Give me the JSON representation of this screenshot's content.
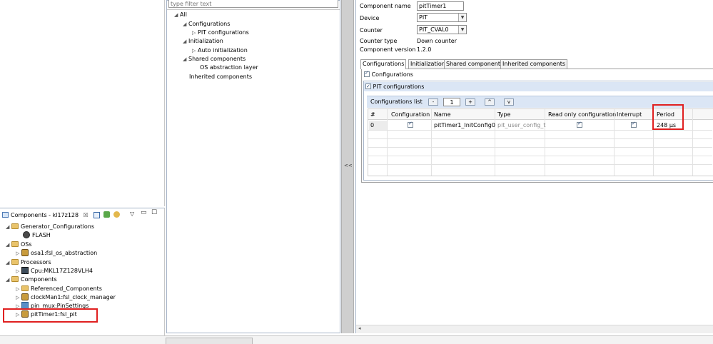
{
  "filter": {
    "placeholder": "type filter text"
  },
  "tree": {
    "all": "All",
    "configurations": "Configurations",
    "pit_configurations": "PIT configurations",
    "initialization": "Initialization",
    "auto_initialization": "Auto initialization",
    "shared_components": "Shared components",
    "os_abstraction_layer": "OS abstraction layer",
    "inherited_components": "Inherited components"
  },
  "collapse_label": "<<",
  "component": {
    "name_label": "Component name",
    "name_value": "pitTimer1",
    "device_label": "Device",
    "device_value": "PIT",
    "counter_label": "Counter",
    "counter_value": "PIT_CVAL0",
    "counter_type_label": "Counter type",
    "counter_type_value": "Down counter",
    "version_label": "Component version",
    "version_value": "1.2.0"
  },
  "tabs": [
    "Configurations",
    "Initialization",
    "Shared components",
    "Inherited components"
  ],
  "config_checkbox_label": "Configurations",
  "pit_section_label": "PIT configurations",
  "config_list": {
    "label": "Configurations list",
    "minus": "-",
    "count": "1",
    "plus": "+",
    "up": "^",
    "down": "v"
  },
  "table": {
    "headers": [
      "#",
      "Configuration",
      "Name",
      "Type",
      "Read only configuration",
      "Interrupt",
      "Period"
    ],
    "row": {
      "index": "0",
      "name": "pitTimer1_InitConfig0",
      "type": "pit_user_config_t",
      "period": "248 µs"
    }
  },
  "components_view": {
    "title": "Components - kl17z128",
    "items": {
      "generator": "Generator_Configurations",
      "flash": "FLASH",
      "oss": "OSs",
      "osa": "osa1:fsl_os_abstraction",
      "processors": "Processors",
      "cpu": "Cpu:MKL17Z128VLH4",
      "components": "Components",
      "referenced": "Referenced_Components",
      "clockman": "clockMan1:fsl_clock_manager",
      "pinmux": "pin_mux:PinSettings",
      "pittimer": "pitTimer1:fsl_pit"
    }
  },
  "colors": {
    "highlight": "#e02020",
    "section_bg": "#dbe6f5",
    "panel_border": "#a6b4c8"
  }
}
